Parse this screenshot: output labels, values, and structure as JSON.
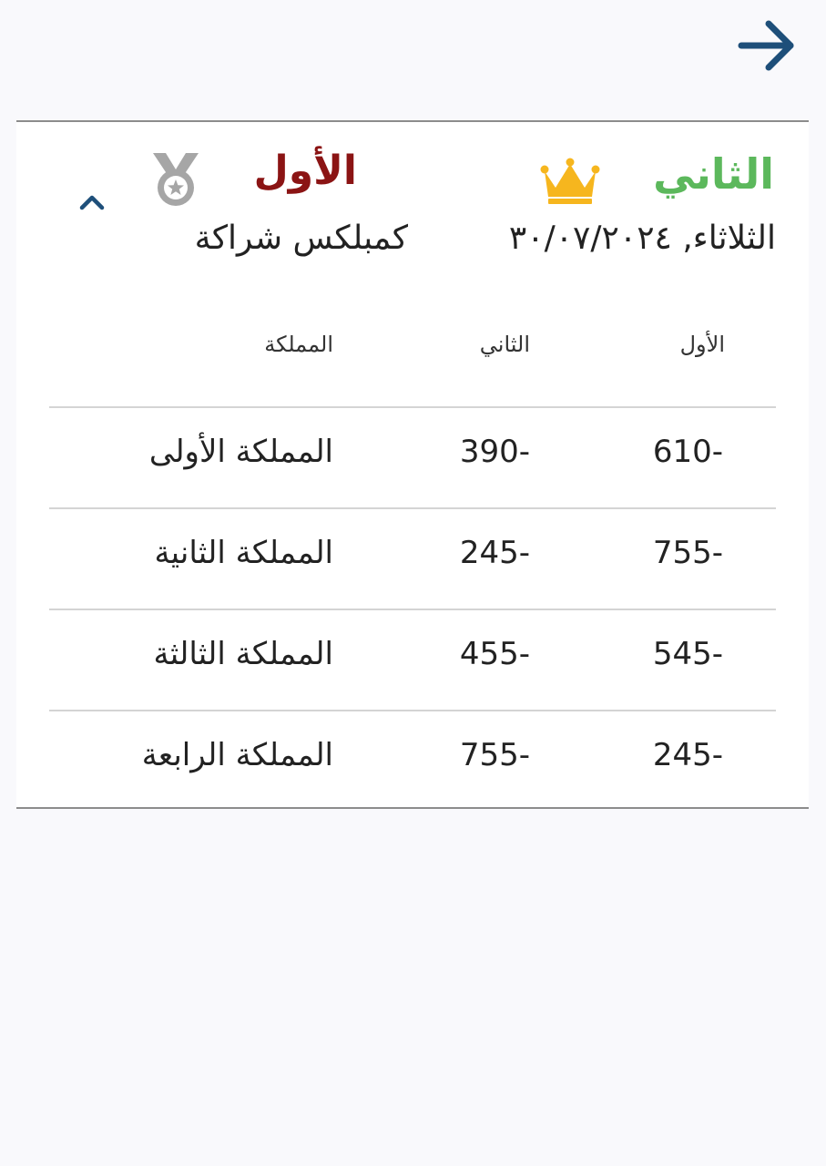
{
  "nav": {
    "back_icon": "arrow-right-icon"
  },
  "match": {
    "winner_label": "الثاني",
    "winner_color": "#5cb85c",
    "winner_icon": "crown-icon",
    "loser_label": "الأول",
    "loser_color": "#8b1414",
    "loser_icon": "silver-medal-icon",
    "date": "الثلاثاء, ٣٠/٠٧/٢٠٢٤",
    "venue": "كمبلكس شراكة",
    "collapse_icon": "chevron-up-icon"
  },
  "table": {
    "headers": {
      "first": "الأول",
      "second": "الثاني",
      "kingdom": "المملكة"
    },
    "rows": [
      {
        "first": "610-",
        "second": "390-",
        "kingdom": "المملكة الأولى"
      },
      {
        "first": "755-",
        "second": "245-",
        "kingdom": "المملكة الثانية"
      },
      {
        "first": "545-",
        "second": "455-",
        "kingdom": "المملكة الثالثة"
      },
      {
        "first": "245-",
        "second": "755-",
        "kingdom": "المملكة الرابعة"
      }
    ]
  },
  "colors": {
    "accent": "#1e4f7a",
    "crown": "#f6b61e",
    "medal": "#a6a6a6"
  }
}
